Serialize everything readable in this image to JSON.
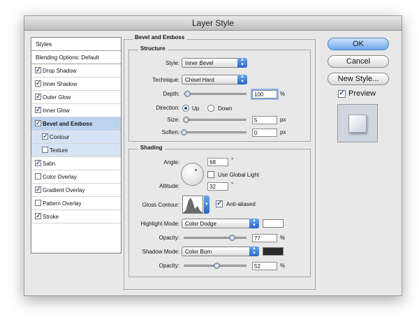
{
  "window": {
    "title": "Layer Style"
  },
  "sidebar": {
    "header": "Styles",
    "blending": "Blending Options: Default",
    "items": [
      {
        "label": "Drop Shadow",
        "checked": true
      },
      {
        "label": "Inner Shadow",
        "checked": true
      },
      {
        "label": "Outer Glow",
        "checked": true
      },
      {
        "label": "Inner Glow",
        "checked": true
      },
      {
        "label": "Bevel and Emboss",
        "checked": true
      },
      {
        "label": "Contour",
        "checked": true
      },
      {
        "label": "Texture",
        "checked": false
      },
      {
        "label": "Satin",
        "checked": true
      },
      {
        "label": "Color Overlay",
        "checked": false
      },
      {
        "label": "Gradient Overlay",
        "checked": true
      },
      {
        "label": "Pattern Overlay",
        "checked": false
      },
      {
        "label": "Stroke",
        "checked": true
      }
    ]
  },
  "bevel": {
    "title": "Bevel and Emboss",
    "structure": {
      "title": "Structure",
      "style_label": "Style:",
      "style_value": "Inner Bevel",
      "technique_label": "Technique:",
      "technique_value": "Chisel Hard",
      "depth_label": "Depth:",
      "depth_value": "100",
      "depth_unit": "%",
      "depth_level": 0.06,
      "direction_label": "Direction:",
      "dir_up": "Up",
      "dir_down": "Down",
      "size_label": "Size:",
      "size_value": "5",
      "size_unit": "px",
      "size_level": 0.03,
      "soften_label": "Soften:",
      "soften_value": "0",
      "soften_unit": "px",
      "soften_level": 0.0
    },
    "shading": {
      "title": "Shading",
      "angle_label": "Angle:",
      "angle_value": "68",
      "angle_unit": "°",
      "global_light": "Use Global Light",
      "altitude_label": "Altitude:",
      "altitude_value": "32",
      "altitude_unit": "°",
      "gloss_label": "Gloss Contour:",
      "anti_aliased": "Anti-aliased",
      "highlight_label": "Highlight Mode:",
      "highlight_value": "Color Dodge",
      "highlight_color": "#ffffff",
      "opacity_label": "Opacity:",
      "highlight_opacity": "77",
      "highlight_opacity_unit": "%",
      "highlight_level": 0.77,
      "shadow_label": "Shadow Mode:",
      "shadow_value": "Color Burn",
      "shadow_color": "#2b2b2b",
      "opacity2_label": "Opacity:",
      "shadow_opacity": "52",
      "shadow_opacity_unit": "%",
      "shadow_level": 0.52
    }
  },
  "buttons": {
    "ok": "OK",
    "cancel": "Cancel",
    "new_style": "New Style...",
    "preview": "Preview"
  }
}
